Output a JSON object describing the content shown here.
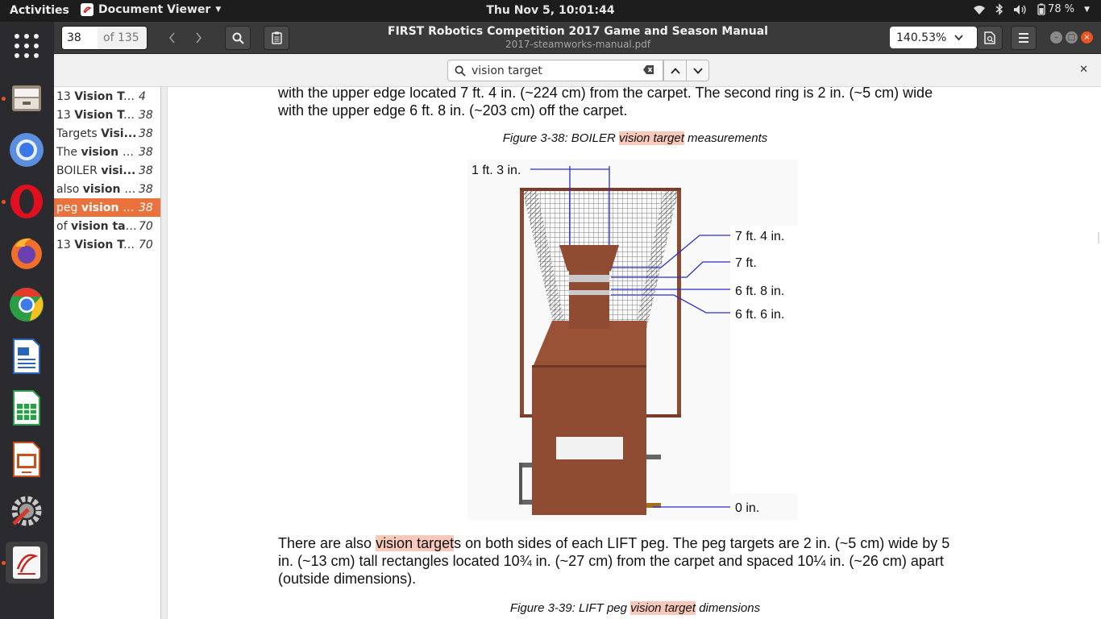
{
  "topbar": {
    "activities": "Activities",
    "app_name": "Document Viewer",
    "clock": "Thu Nov  5, 10:01:44",
    "battery": "78 %"
  },
  "dock": {
    "items": [
      "files",
      "chromium",
      "opera",
      "firefox",
      "chrome",
      "writer",
      "calc",
      "impress",
      "settings",
      "document-viewer"
    ]
  },
  "header": {
    "page_number": "38",
    "page_total": "of 135",
    "title": "FIRST Robotics Competition 2017 Game and Season Manual",
    "subtitle": "2017-steamworks-manual.pdf",
    "zoom": "140.53%"
  },
  "find": {
    "query": "vision target"
  },
  "results": [
    {
      "pre": "13 ",
      "bold": "Vision Ta...",
      "post": "",
      "page": "4"
    },
    {
      "pre": "13 ",
      "bold": "Vision Ta...",
      "post": "",
      "page": "38"
    },
    {
      "pre": "Targets ",
      "bold": "Visi...",
      "post": "",
      "page": "38"
    },
    {
      "pre": "The ",
      "bold": "vision t...",
      "post": "",
      "page": "38"
    },
    {
      "pre": "BOILER ",
      "bold": "visi...",
      "post": "",
      "page": "38"
    },
    {
      "pre": "also ",
      "bold": "vision t...",
      "post": "",
      "page": "38"
    },
    {
      "pre": "peg ",
      "bold": "vision t...",
      "post": "",
      "page": "38"
    },
    {
      "pre": "of ",
      "bold": "vision ta...",
      "post": "",
      "page": "70"
    },
    {
      "pre": "13 ",
      "bold": "Vision Ta...",
      "post": "",
      "page": "70"
    }
  ],
  "doc": {
    "para1_line1": "with the upper edge located 7 ft. 4 in. (~224 cm) from the carpet. The second ring is 2 in. (~5 cm) wide",
    "para1_line2": "with the upper edge 6 ft. 8 in. (~203 cm) off the carpet.",
    "fig38_pre": "Figure 3-38: BOILER ",
    "fig38_hl": "vision target",
    "fig38_post": " measurements",
    "labels": {
      "width": "1 ft. 3 in.",
      "l74": "7 ft. 4 in.",
      "l7": "7 ft.",
      "l68": "6 ft. 8 in.",
      "l66": "6 ft. 6 in.",
      "l0": "0 in."
    },
    "para2_pre": "There are also ",
    "para2_hl": "vision target",
    "para2_post": "s on both sides of each LIFT peg. The peg targets are 2 in. (~5 cm) wide by 5",
    "para2_line2": "in. (~13 cm) tall rectangles located 10¾ in. (~27 cm) from the carpet and spaced 10¼ in. (~26 cm) apart",
    "para2_line3": "(outside dimensions).",
    "fig39_pre": "Figure 3-39: LIFT peg ",
    "fig39_hl": "vision target",
    "fig39_post": " dimensions"
  }
}
